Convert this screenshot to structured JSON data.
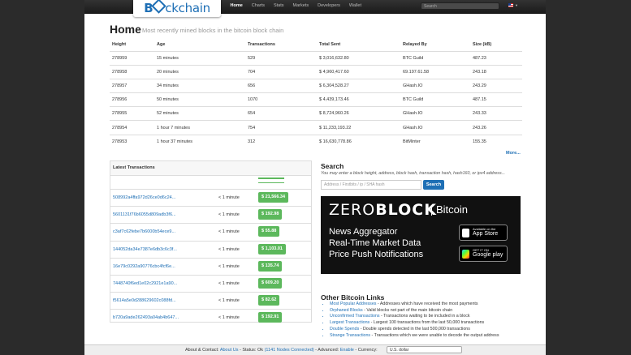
{
  "brand": {
    "logo_text": "Blockchain"
  },
  "nav": {
    "items": [
      "Home",
      "Charts",
      "Stats",
      "Markets",
      "Developers",
      "Wallet"
    ],
    "search_placeholder": "Search"
  },
  "page": {
    "title": "Home",
    "subtitle": "Most recently mined blocks in the bitcoin block chain"
  },
  "blocks_table": {
    "headers": [
      "Height",
      "Age",
      "Transactions",
      "Total Sent",
      "Relayed By",
      "Size (kB)"
    ],
    "rows": [
      [
        "278959",
        "15 minutes",
        "529",
        "$ 3,016,632.80",
        "BTC Guild",
        "487.23"
      ],
      [
        "278958",
        "20 minutes",
        "704",
        "$ 4,960,417.60",
        "69.197.61.58",
        "243.18"
      ],
      [
        "278957",
        "34 minutes",
        "656",
        "$ 6,304,528.27",
        "GHash.IO",
        "243.29"
      ],
      [
        "278956",
        "50 minutes",
        "1070",
        "$ 4,439,173.46",
        "BTC Guild",
        "487.15"
      ],
      [
        "278955",
        "52 minutes",
        "654",
        "$ 8,724,960.26",
        "GHash.IO",
        "243.33"
      ],
      [
        "278954",
        "1 hour 7 minutes",
        "754",
        "$ 11,233,193.22",
        "GHash.IO",
        "243.26"
      ],
      [
        "278953",
        "1 hour 37 minutes",
        "312",
        "$ 16,630,778.86",
        "BitMinter",
        "155.35"
      ]
    ],
    "more_label": "More..."
  },
  "transactions": {
    "title": "Latest Transactions",
    "rows": [
      {
        "hash": "508992a4ffa972d26ce0d6c24...",
        "time": "< 1 minute",
        "amount": "$ 21,566.34"
      },
      {
        "hash": "5601131f76b6055d809adb3f6...",
        "time": "< 1 minute",
        "amount": "$ 192.98"
      },
      {
        "hash": "c3af7c62febe7b6000b54ece9...",
        "time": "< 1 minute",
        "amount": "$ 55.88"
      },
      {
        "hash": "144052da34e7387e6db3c6c3f...",
        "time": "< 1 minute",
        "amount": "$ 1,103.01"
      },
      {
        "hash": "16e79c0292a90776cbc4fcf6e...",
        "time": "< 1 minute",
        "amount": "$ 135.74"
      },
      {
        "hash": "7448740f6ed1e02c2921e1a90...",
        "time": "< 1 minute",
        "amount": "$ 609.20"
      },
      {
        "hash": "f5614a5e0d288629602c088fd...",
        "time": "< 1 minute",
        "amount": "$ 82.62"
      },
      {
        "hash": "b720a9ade262493a04ab4b647...",
        "time": "< 1 minute",
        "amount": "$ 192.91"
      }
    ]
  },
  "search": {
    "title": "Search",
    "help": "You may enter a block height, address, block hash, transaction hash, hash160, or ipv4 address...",
    "placeholder": "Address / Firstbits / ip / SHA hash",
    "button": "Search"
  },
  "ad": {
    "brand_a": "ZERO",
    "brand_b": "BLOCK",
    "brand_c": "Bitcoin",
    "lines": [
      "News Aggregator",
      "Real-Time Market Data",
      "Price Push Notifications"
    ],
    "appstore_small": "Available on the",
    "appstore": "App Store",
    "googleplay_small": "GET IT ON",
    "googleplay": "Google play"
  },
  "other_links": {
    "title": "Other Bitcoin Links",
    "items": [
      {
        "link": "Most Popular Addresses",
        "desc": " - Addresses which have received the most payments"
      },
      {
        "link": "Orphaned Blocks",
        "desc": " - Valid blocks not part of the main bitcoin chain"
      },
      {
        "link": "Unconfirmed Transactions",
        "desc": " - Transactions waiting to be included in a block"
      },
      {
        "link": "Largest Transactions",
        "desc": " - Largest 100 transactions from the last 50,000 transactions"
      },
      {
        "link": "Double Spends",
        "desc": " - Double spends detected in the last 500,000 transactions"
      },
      {
        "link": "Strange Transactions",
        "desc": " - Transactions which we were unable to decode the output address"
      }
    ]
  },
  "footer": {
    "about_label": "About & Contact:",
    "about_link": "About Us",
    "status_label": " - Status:",
    "status_ok": "Ok",
    "nodes_link": "(1141 Nodes Connected)",
    "advanced_label": " - Advanced:",
    "advanced_link": "Enable",
    "currency_label": " - Currency:",
    "currency_value": "U.S. dollar"
  }
}
